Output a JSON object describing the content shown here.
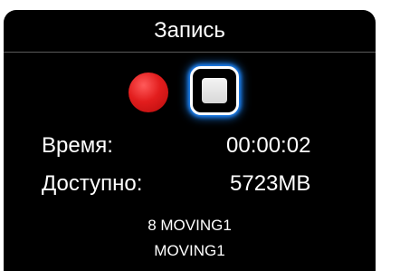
{
  "title": "Запись",
  "controls": {
    "record_icon": "record-circle",
    "stop_icon": "stop-square",
    "accent_color": "#1e88ff",
    "record_color": "#e21d1d"
  },
  "stats": {
    "time_label": "Время:",
    "time_value": "00:00:02",
    "available_label": "Доступно:",
    "available_value": "5723MB"
  },
  "info": {
    "line1": "8 MOVING1",
    "line2": "MOVING1"
  }
}
